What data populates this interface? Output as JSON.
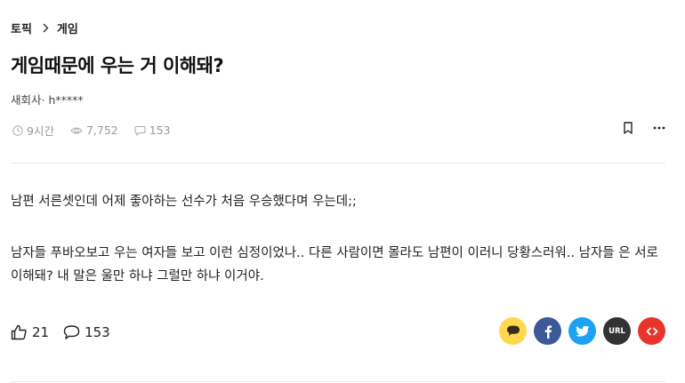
{
  "breadcrumb": {
    "topic": "토픽",
    "category": "게임"
  },
  "post": {
    "title": "게임때문에 우는 거 이해돼?",
    "author": "새회사· h*****",
    "time": "9시간",
    "views": "7,752",
    "comments": "153",
    "paragraphs": [
      "남편 서른셋인데 어제 좋아하는 선수가 처음 우승했다며 우는데;;",
      "남자들 푸바오보고 우는 여자들 보고 이런 심정이었나.. 다른 사람이면 몰라도 남편이 이러니 당황스러워.. 남자들 은 서로 이해돼? 내 말은 울만 하냐 그럴만 하냐 이거야."
    ]
  },
  "actions": {
    "likes": "21",
    "comments": "153"
  },
  "share": {
    "kakao_color": "#FFD84D",
    "facebook_color": "#3B5998",
    "twitter_color": "#1DA1F2",
    "url_color": "#333333",
    "url_label": "URL",
    "embed_color": "#E7352B"
  },
  "icons": [
    "chevron-right-icon",
    "clock-icon",
    "eye-icon",
    "comment-icon",
    "bookmark-icon",
    "more-icon",
    "thumbs-up-icon",
    "kakao-icon",
    "facebook-icon",
    "twitter-icon",
    "url-icon",
    "embed-icon"
  ]
}
